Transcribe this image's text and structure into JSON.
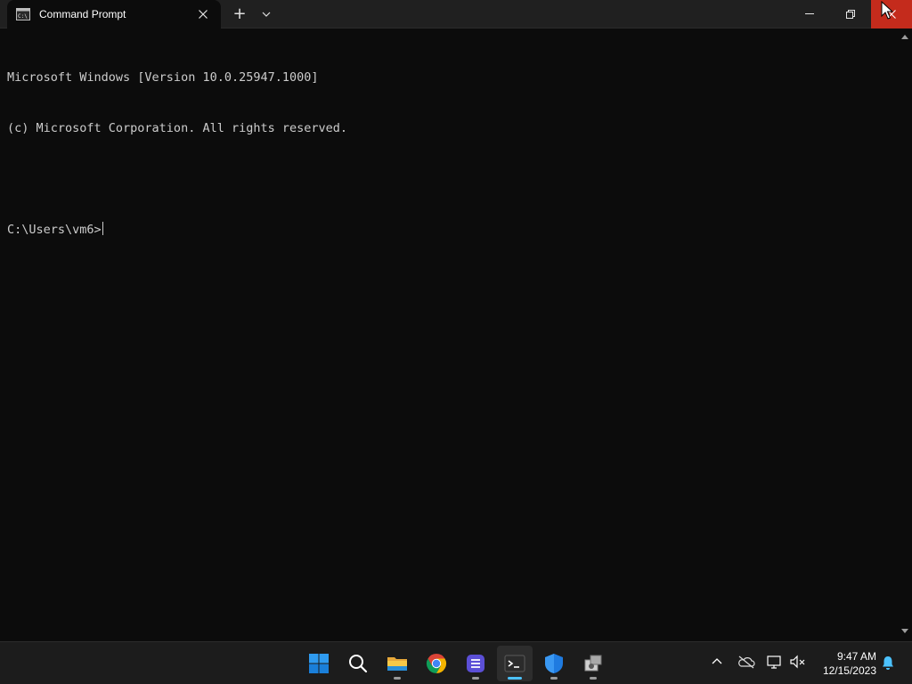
{
  "titlebar": {
    "tab_title": "Command Prompt",
    "tab_icon": "cmd-icon",
    "close_tab_icon": "close-icon",
    "new_tab_label": "+",
    "dropdown_icon": "chevron-down-icon",
    "window_controls": [
      "minimize-icon",
      "restore-icon",
      "close-icon"
    ],
    "close_hover_color": "#c42b1c"
  },
  "console": {
    "lines": [
      "Microsoft Windows [Version 10.0.25947.1000]",
      "(c) Microsoft Corporation. All rights reserved.",
      "",
      "C:\\Users\\vm6>"
    ],
    "background": "#0c0c0c",
    "foreground": "#cccccc"
  },
  "taskbar": {
    "apps": [
      {
        "name": "start",
        "icon": "windows-logo-icon"
      },
      {
        "name": "search",
        "icon": "search-icon"
      },
      {
        "name": "file-explorer",
        "icon": "folder-icon",
        "running": true
      },
      {
        "name": "chrome",
        "icon": "chrome-icon"
      },
      {
        "name": "app-purple",
        "icon": "app-icon",
        "running": true
      },
      {
        "name": "terminal",
        "icon": "terminal-icon",
        "running": true,
        "active": true
      },
      {
        "name": "defender",
        "icon": "shield-icon",
        "running": true
      },
      {
        "name": "setup",
        "icon": "installer-icon",
        "running": true
      }
    ],
    "tray": [
      "chevron-up-icon",
      "onedrive-icon",
      "network-icon",
      "volume-muted-icon"
    ],
    "time": "9:47 AM",
    "date": "12/15/2023",
    "accent": "#4cc2ff"
  }
}
